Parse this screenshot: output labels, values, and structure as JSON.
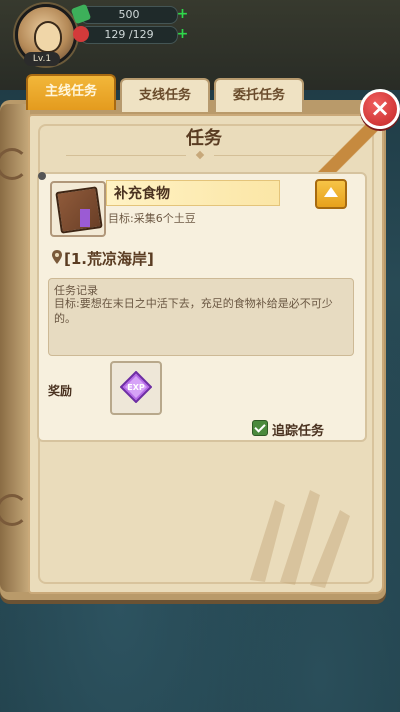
{
  "hud": {
    "level": "Lv.1",
    "energy": "500",
    "hp": "129 /129"
  },
  "tabs": [
    {
      "label": "主线任务"
    },
    {
      "label": "支线任务"
    },
    {
      "label": "委托任务"
    }
  ],
  "page": {
    "title": "任务"
  },
  "quest": {
    "name": "补充食物",
    "target": "目标:采集6个土豆",
    "location": "[1.荒凉海岸]",
    "log_title": "任务记录",
    "log_text": "目标:要想在末日之中活下去，充足的食物补给是必不可少的。",
    "reward_label": "奖励",
    "track_label": "追踪任务"
  },
  "icons": {
    "close": "close-icon",
    "collapse": "chevron-up-icon",
    "quest": "book-icon",
    "location": "location-pin-icon",
    "reward": "exp-gem-icon",
    "track": "checkbox-icon"
  },
  "colors": {
    "tab_active": "#e49b1e",
    "tab_inactive": "#efe2c3",
    "close_button": "#d43030",
    "check": "#4b8a3d"
  }
}
